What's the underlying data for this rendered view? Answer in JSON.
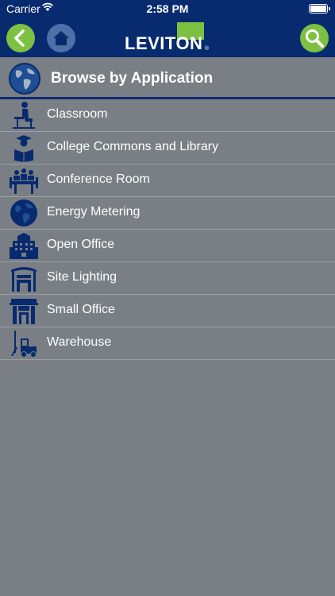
{
  "status": {
    "carrier": "Carrier",
    "time": "2:58 PM"
  },
  "nav": {
    "logo_text": "LEVITON",
    "logo_reg": "®"
  },
  "header": {
    "title": "Browse by Application"
  },
  "colors": {
    "navy": "#082a6e",
    "green": "#7dc142",
    "gray": "#7a7f86"
  },
  "items": [
    {
      "label": "Classroom",
      "icon": "classroom-icon"
    },
    {
      "label": "College Commons and Library",
      "icon": "graduate-icon"
    },
    {
      "label": "Conference Room",
      "icon": "conference-icon"
    },
    {
      "label": "Energy Metering",
      "icon": "globe-icon"
    },
    {
      "label": "Open Office",
      "icon": "building-icon"
    },
    {
      "label": "Site Lighting",
      "icon": "site-lighting-icon"
    },
    {
      "label": "Small Office",
      "icon": "small-office-icon"
    },
    {
      "label": "Warehouse",
      "icon": "forklift-icon"
    }
  ]
}
